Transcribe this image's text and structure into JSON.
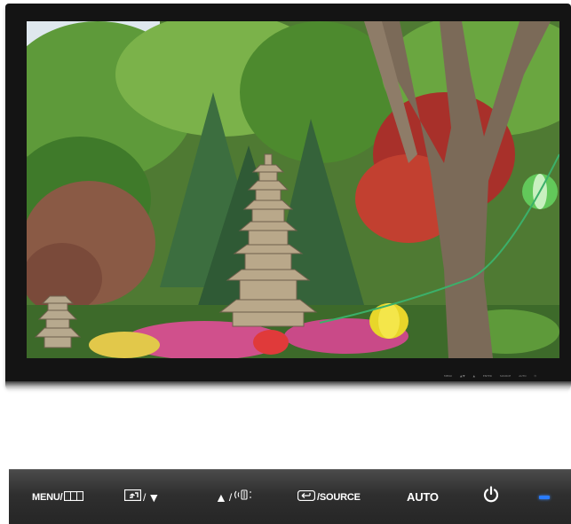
{
  "bezel": {
    "labels": [
      "MENU",
      "▲/▼",
      "▲",
      "ENTER",
      "SOURCE",
      "AUTO",
      "⏻"
    ]
  },
  "controls": {
    "menu_label": "MENU/",
    "adjust_slash": "/",
    "adjust_down_symbol": "▼",
    "brightness_up_symbol": "▲",
    "brightness_slash": "/",
    "source_label": "/SOURCE",
    "auto_label": "AUTO"
  },
  "colors": {
    "led": "#2a7cff",
    "bezel": "#141414",
    "control_bar": "#2f2f2f"
  },
  "icons": {
    "menu": "menu-grid-icon",
    "adjust": "enter-box-icon",
    "brightness": "brightness-icon",
    "source": "source-input-icon",
    "power": "power-icon",
    "led": "power-led-indicator"
  }
}
